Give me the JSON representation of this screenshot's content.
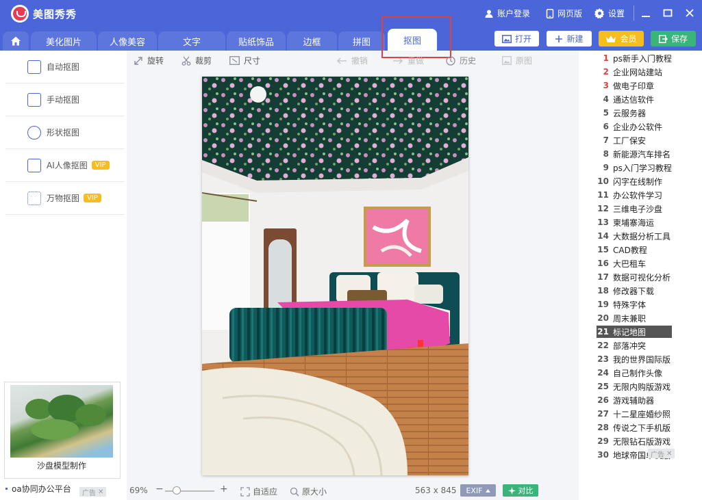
{
  "app": {
    "title": "美图秀秀"
  },
  "titlebar": {
    "login": "账户登录",
    "web": "网页版",
    "settings": "设置"
  },
  "tabs": [
    {
      "label": "美化图片"
    },
    {
      "label": "人像美容"
    },
    {
      "label": "文字"
    },
    {
      "label": "贴纸饰品"
    },
    {
      "label": "边框"
    },
    {
      "label": "拼图"
    },
    {
      "label": "抠图"
    }
  ],
  "actions": {
    "open": "打开",
    "new": "新建",
    "vip": "会员",
    "save": "保存"
  },
  "left_menu": [
    {
      "label": "自动抠图",
      "vip": ""
    },
    {
      "label": "手动抠图",
      "vip": ""
    },
    {
      "label": "形状抠图",
      "vip": ""
    },
    {
      "label": "AI人像抠图",
      "vip": "VIP"
    },
    {
      "label": "万物抠图",
      "vip": "VIP"
    }
  ],
  "ad": {
    "caption": "沙盘模型制作",
    "link": "oa协同办公平台",
    "tag": "广告"
  },
  "toolbar": {
    "rotate": "旋转",
    "crop": "裁剪",
    "size": "尺寸",
    "undo": "撤销",
    "redo": "重做",
    "history": "历史",
    "original": "原图"
  },
  "status": {
    "zoom": "69%",
    "fit": "自适应",
    "actual": "原大小",
    "dims": "563 x 845",
    "exif": "EXIF",
    "compare": "对比"
  },
  "zoom_level": 0.69,
  "ranking": [
    {
      "n": "1",
      "label": "ps新手入门教程"
    },
    {
      "n": "2",
      "label": "企业网站建站"
    },
    {
      "n": "3",
      "label": "做电子印章"
    },
    {
      "n": "4",
      "label": "通达信软件"
    },
    {
      "n": "5",
      "label": "云服务器"
    },
    {
      "n": "6",
      "label": "企业办公软件"
    },
    {
      "n": "7",
      "label": "工厂保安"
    },
    {
      "n": "8",
      "label": "新能源汽车排名"
    },
    {
      "n": "9",
      "label": "ps入门学习教程"
    },
    {
      "n": "10",
      "label": "闪字在线制作"
    },
    {
      "n": "11",
      "label": "办公软件学习"
    },
    {
      "n": "12",
      "label": "三维电子沙盘"
    },
    {
      "n": "13",
      "label": "柬埔寨海运"
    },
    {
      "n": "14",
      "label": "大数据分析工具"
    },
    {
      "n": "15",
      "label": "CAD教程"
    },
    {
      "n": "16",
      "label": "大巴租车"
    },
    {
      "n": "17",
      "label": "数据可视化分析"
    },
    {
      "n": "18",
      "label": "修改器下载"
    },
    {
      "n": "19",
      "label": "特殊字体"
    },
    {
      "n": "20",
      "label": "周末兼职"
    },
    {
      "n": "21",
      "label": "标记地图"
    },
    {
      "n": "22",
      "label": "部落冲突"
    },
    {
      "n": "23",
      "label": "我的世界国际版"
    },
    {
      "n": "24",
      "label": "自己制作头像"
    },
    {
      "n": "25",
      "label": "无限内购版游戏"
    },
    {
      "n": "26",
      "label": "游戏辅助器"
    },
    {
      "n": "27",
      "label": "十二星座婚纱照"
    },
    {
      "n": "28",
      "label": "传说之下手机版"
    },
    {
      "n": "29",
      "label": "无限钻石版游戏"
    },
    {
      "n": "30",
      "label": "地球帝国单机版"
    }
  ],
  "ranking_selected": "21",
  "colors": {
    "brand": "#4a66d8",
    "vip": "#f5bd1f",
    "save": "#3ab47a",
    "highlight": "#e04040"
  }
}
